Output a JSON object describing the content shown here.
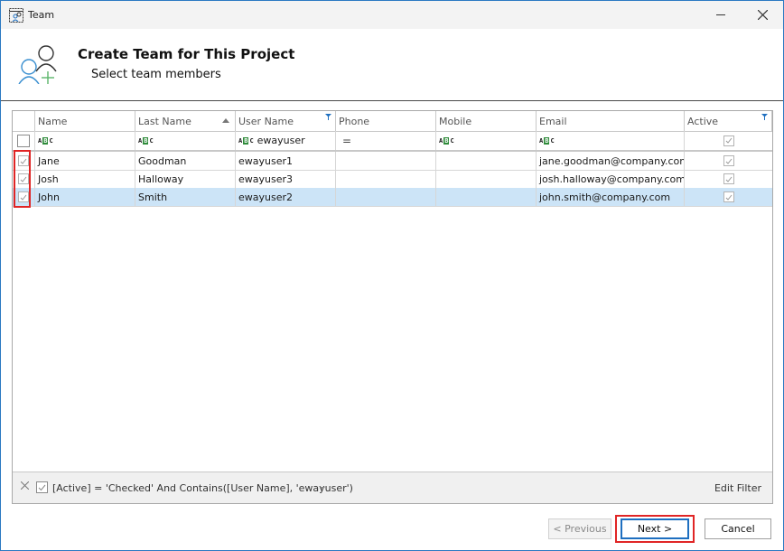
{
  "window": {
    "title": "Team",
    "icons": {
      "app": "team-app-icon",
      "minimize": "minimize-icon",
      "close": "close-icon"
    }
  },
  "header": {
    "title": "Create Team for This Project",
    "subtitle": "Select team members",
    "icon": "add-users-icon"
  },
  "grid": {
    "columns": [
      {
        "label": "",
        "key": "select"
      },
      {
        "label": "Name",
        "key": "name"
      },
      {
        "label": "Last Name",
        "key": "last_name",
        "sort": "ascending"
      },
      {
        "label": "User Name",
        "key": "user_name",
        "filtered": true
      },
      {
        "label": "Phone",
        "key": "phone"
      },
      {
        "label": "Mobile",
        "key": "mobile"
      },
      {
        "label": "Email",
        "key": "email"
      },
      {
        "label": "Active",
        "key": "active",
        "filtered": true
      }
    ],
    "filter_row": {
      "select": false,
      "name": "",
      "last_name": "",
      "user_name": "ewayuser",
      "phone_operator": "=",
      "mobile": "",
      "email": "",
      "active": true,
      "abc_icon": {
        "a": "A",
        "b": "B",
        "c": "C"
      }
    },
    "rows": [
      {
        "selected": true,
        "name": "Jane",
        "last_name": "Goodman",
        "user_name": "ewayuser1",
        "phone": "",
        "mobile": "",
        "email": "jane.goodman@company.com",
        "active": true,
        "focused": false
      },
      {
        "selected": true,
        "name": "Josh",
        "last_name": "Halloway",
        "user_name": "ewayuser3",
        "phone": "",
        "mobile": "",
        "email": "josh.halloway@company.com",
        "active": true,
        "focused": false
      },
      {
        "selected": true,
        "name": "John",
        "last_name": "Smith",
        "user_name": "ewayuser2",
        "phone": "",
        "mobile": "",
        "email": "john.smith@company.com",
        "active": true,
        "focused": true
      }
    ]
  },
  "filter_panel": {
    "enabled": true,
    "expression": "[Active] = 'Checked' And Contains([User Name], 'ewayuser')",
    "edit_label": "Edit Filter"
  },
  "buttons": {
    "previous": "< Previous",
    "next": "Next >",
    "cancel": "Cancel"
  },
  "colors": {
    "accent": "#2b79c2",
    "selection": "#cce4f7",
    "highlight": "#e02525",
    "abc_green": "#2e8b3a",
    "filter_icon": "#1e6fc0"
  }
}
